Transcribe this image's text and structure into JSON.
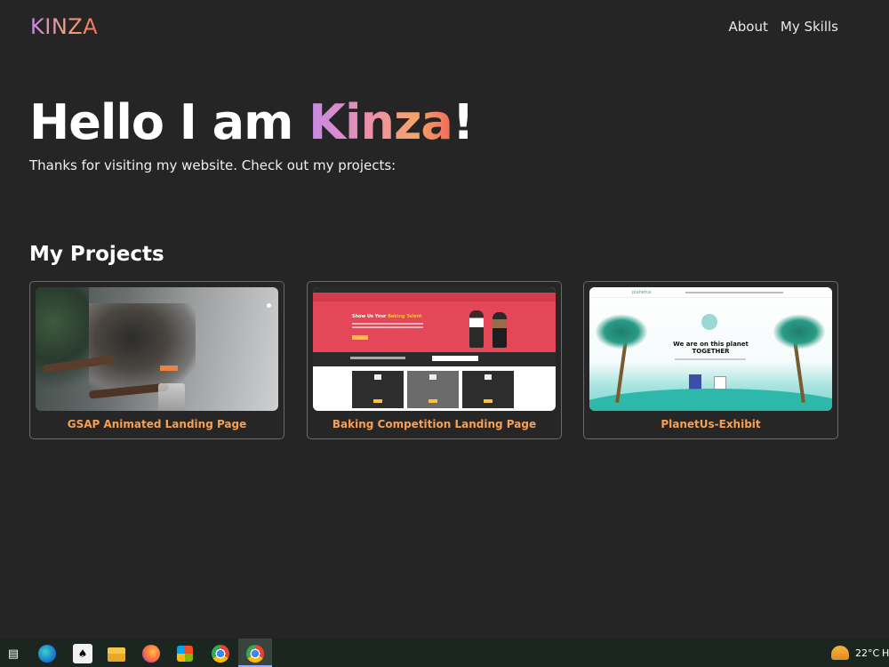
{
  "header": {
    "logo": "KINZA",
    "nav": [
      {
        "label": "About"
      },
      {
        "label": "My Skills"
      }
    ]
  },
  "hero": {
    "title_prefix": "Hello I am ",
    "name": "Kinza",
    "title_suffix": "!",
    "subtitle": "Thanks for visiting my website. Check out my projects:"
  },
  "projects": {
    "heading": "My Projects",
    "items": [
      {
        "title": "GSAP Animated Landing Page",
        "thumbnail": "coffee-machine-screenshot"
      },
      {
        "title": "Baking Competition Landing Page",
        "thumbnail": "baking-site-screenshot",
        "thumb_text": "Show Us Your",
        "thumb_text_accent": "Baking Talent"
      },
      {
        "title": "PlanetUs-Exhibit",
        "thumbnail": "planetus-site-screenshot",
        "thumb_brand": "planetus",
        "thumb_heading": "We are on this planet",
        "thumb_heading2": "TOGETHER"
      }
    ]
  },
  "taskbar": {
    "icons": [
      "task-view-icon",
      "edge-icon",
      "solitaire-icon",
      "file-explorer-icon",
      "firefox-icon",
      "microsoft-store-icon",
      "chrome-icon",
      "chrome-icon"
    ],
    "weather_temp": "22°C",
    "overflow_text": "H"
  },
  "colors": {
    "background": "#252525",
    "accent_orange": "#f5a055",
    "gradient_start": "#c68ae8",
    "gradient_end": "#f06a5a"
  }
}
